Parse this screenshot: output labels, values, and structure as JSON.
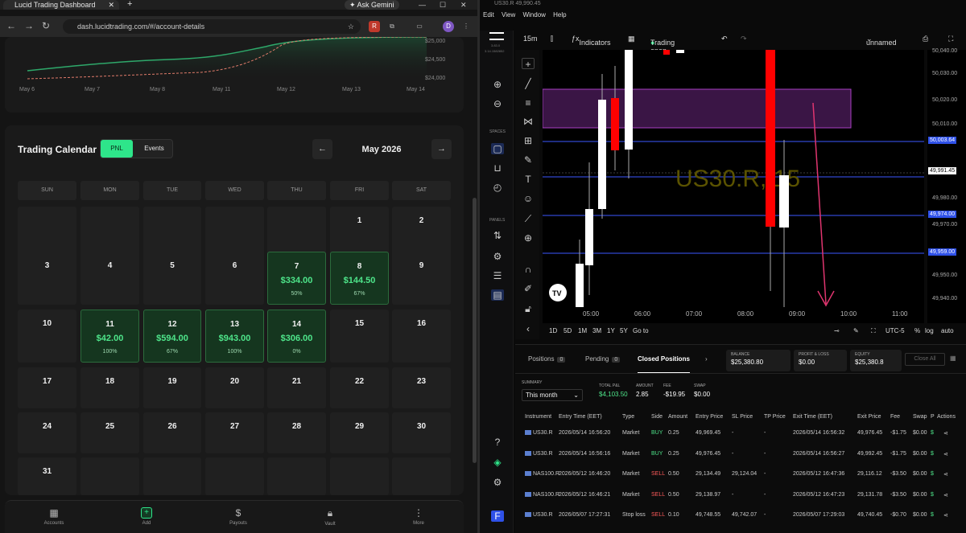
{
  "browser": {
    "tab_title": "Lucid Trading Dashboard",
    "gemini_label": "Ask Gemini",
    "url": "dash.lucidtrading.com/#/account-details",
    "profile_initial": "D"
  },
  "equity_chart": {
    "y_ticks": [
      "$25,000",
      "$24,500",
      "$24,000"
    ],
    "x_ticks": [
      "May 6",
      "May 7",
      "May 8",
      "May 11",
      "May 12",
      "May 13",
      "May 14"
    ]
  },
  "calendar": {
    "title": "Trading Calendar",
    "toggle": {
      "pnl": "PNL",
      "events": "Events"
    },
    "prev": "←",
    "next": "→",
    "month": "May 2026",
    "weekdays": [
      "SUN",
      "MON",
      "TUE",
      "WED",
      "THU",
      "FRI",
      "SAT"
    ],
    "days": {
      "d1": "1",
      "d2": "2",
      "d3": "3",
      "d4": "4",
      "d5": "5",
      "d6": "6",
      "d7": "7",
      "d8": "8",
      "d9": "9",
      "d10": "10",
      "d11": "11",
      "d12": "12",
      "d13": "13",
      "d14": "14",
      "d15": "15",
      "d16": "16",
      "d17": "17",
      "d18": "18",
      "d19": "19",
      "d20": "20",
      "d21": "21",
      "d22": "22",
      "d23": "23",
      "d24": "24",
      "d25": "25",
      "d26": "26",
      "d27": "27",
      "d28": "28",
      "d29": "29",
      "d30": "30",
      "d31": "31"
    },
    "pnl": {
      "d7": {
        "amount": "$334.00",
        "pct": "50%"
      },
      "d8": {
        "amount": "$144.50",
        "pct": "67%"
      },
      "d11": {
        "amount": "$42.00",
        "pct": "100%"
      },
      "d12": {
        "amount": "$594.00",
        "pct": "67%"
      },
      "d13": {
        "amount": "$943.00",
        "pct": "100%"
      },
      "d14": {
        "amount": "$306.00",
        "pct": "0%"
      }
    }
  },
  "bottom_nav": {
    "accounts": "Accounts",
    "add": "Add",
    "payouts": "Payouts",
    "vault": "Vault",
    "more": "More"
  },
  "platform": {
    "window_title": "US30.R 49,990.45",
    "menu": [
      "Edit",
      "View",
      "Window",
      "Help"
    ],
    "timeframe": "15m",
    "indicators": "Indicators",
    "trading_status": "Trading open",
    "layout_name": "unnamed",
    "symbol_watermark": "US30.R, 15",
    "version": "3.83.0",
    "build": "3.14.1582852",
    "spaces_label": "SPACES",
    "panels_label": "PANELS",
    "price_labels": [
      "50,040.00",
      "50,030.00",
      "50,020.00",
      "50,010.00",
      "49,980.00",
      "49,970.00",
      "49,950.00",
      "49,940.00"
    ],
    "price_tags": {
      "a": "50,003.64",
      "b": "49,974.00",
      "c": "49,959.00"
    },
    "current_price": "49,991.45",
    "time_labels": [
      "05:00",
      "06:00",
      "07:00",
      "08:00",
      "09:00",
      "10:00",
      "11:00"
    ],
    "ranges": [
      "1D",
      "5D",
      "1M",
      "3M",
      "1Y",
      "5Y",
      "Go to"
    ],
    "range_right": {
      "tz": "UTC-5",
      "pct": "%",
      "log": "log",
      "auto": "auto"
    }
  },
  "positions_panel": {
    "tabs": {
      "positions": "Positions",
      "positions_count": "0",
      "pending": "Pending",
      "pending_count": "0",
      "closed": "Closed Positions"
    },
    "balance": {
      "label": "BALANCE",
      "value": "$25,380.80"
    },
    "pnl": {
      "label": "PROFIT & LOSS",
      "value": "$0.00"
    },
    "equity": {
      "label": "EQUITY",
      "value": "$25,380.8"
    },
    "close_all": "Close All",
    "summary_label": "SUMMARY",
    "period": "This month",
    "total_pnl": {
      "label": "TOTAL P&L",
      "value": "$4,103.50"
    },
    "amount": {
      "label": "AMOUNT",
      "value": "2.85"
    },
    "fee": {
      "label": "FEE",
      "value": "-$19.95"
    },
    "swap": {
      "label": "SWAP",
      "value": "$0.00"
    },
    "columns": [
      "Instrument",
      "Entry Time (EET)",
      "Type",
      "Side",
      "Amount",
      "Entry Price",
      "SL Price",
      "TP Price",
      "Exit Time (EET)",
      "Exit Price",
      "Fee",
      "Swap",
      "P",
      "Actions"
    ],
    "rows": [
      {
        "inst": "US30.R",
        "entry_time": "2026/05/14 16:56:20",
        "type": "Market",
        "side": "BUY",
        "amount": "0.25",
        "entry": "49,969.45",
        "sl": "-",
        "tp": "-",
        "exit_time": "2026/05/14 16:56:32",
        "exit": "49,976.45",
        "fee": "-$1.75",
        "swap": "$0.00",
        "p": "$"
      },
      {
        "inst": "US30.R",
        "entry_time": "2026/05/14 16:56:16",
        "type": "Market",
        "side": "BUY",
        "amount": "0.25",
        "entry": "49,976.45",
        "sl": "-",
        "tp": "-",
        "exit_time": "2026/05/14 16:56:27",
        "exit": "49,992.45",
        "fee": "-$1.75",
        "swap": "$0.00",
        "p": "$"
      },
      {
        "inst": "NAS100.R",
        "entry_time": "2026/05/12 16:46:20",
        "type": "Market",
        "side": "SELL",
        "amount": "0.50",
        "entry": "29,134.49",
        "sl": "29,124.04",
        "tp": "-",
        "exit_time": "2026/05/12 16:47:36",
        "exit": "29,116.12",
        "fee": "-$3.50",
        "swap": "$0.00",
        "p": "$"
      },
      {
        "inst": "NAS100.R",
        "entry_time": "2026/05/12 16:46:21",
        "type": "Market",
        "side": "SELL",
        "amount": "0.50",
        "entry": "29,138.97",
        "sl": "-",
        "tp": "-",
        "exit_time": "2026/05/12 16:47:23",
        "exit": "29,131.78",
        "fee": "-$3.50",
        "swap": "$0.00",
        "p": "$"
      },
      {
        "inst": "US30.R",
        "entry_time": "2026/05/07 17:27:31",
        "type": "Stop loss",
        "side": "SELL",
        "amount": "0.10",
        "entry": "49,748.55",
        "sl": "49,742.07",
        "tp": "-",
        "exit_time": "2026/05/07 17:29:03",
        "exit": "49,740.45",
        "fee": "-$0.70",
        "swap": "$0.00",
        "p": "$"
      }
    ]
  }
}
